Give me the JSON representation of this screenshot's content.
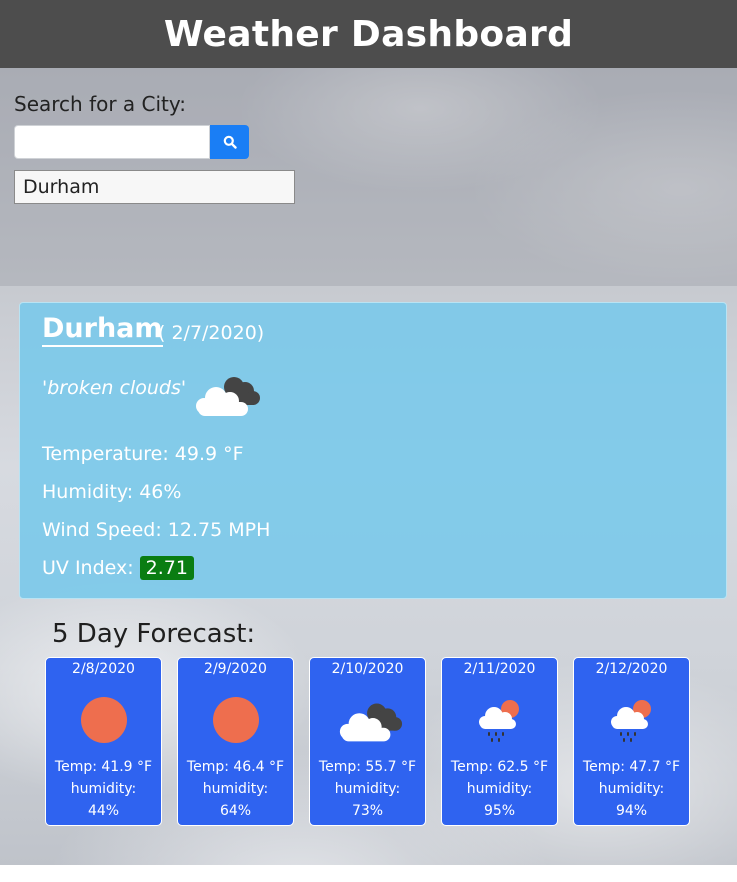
{
  "app": {
    "title": "Weather Dashboard"
  },
  "search": {
    "label": "Search for a City:",
    "input_value": "",
    "placeholder": "",
    "button_icon": "search-icon",
    "history": [
      "Durham"
    ]
  },
  "current": {
    "city": "Durham",
    "date": "( 2/7/2020)",
    "description": "'broken clouds'",
    "icon": "broken-clouds-icon",
    "temperature": "Temperature: 49.9 °F",
    "humidity": "Humidity: 46%",
    "wind": "Wind Speed: 12.75 MPH",
    "uv_label": "UV Index:",
    "uv_value": "2.71",
    "uv_color": "#0a7d12"
  },
  "forecast": {
    "title": "5 Day Forecast:",
    "humidity_label": "humidity:",
    "days": [
      {
        "date": "2/8/2020",
        "icon": "sun-icon",
        "temp": "Temp: 41.9 °F",
        "humidity": "44%"
      },
      {
        "date": "2/9/2020",
        "icon": "sun-icon",
        "temp": "Temp: 46.4 °F",
        "humidity": "64%"
      },
      {
        "date": "2/10/2020",
        "icon": "broken-clouds-icon",
        "temp": "Temp: 55.7 °F",
        "humidity": "73%"
      },
      {
        "date": "2/11/2020",
        "icon": "rain-sun-icon",
        "temp": "Temp: 62.5 °F",
        "humidity": "95%"
      },
      {
        "date": "2/12/2020",
        "icon": "rain-sun-icon",
        "temp": "Temp: 47.7 °F",
        "humidity": "94%"
      }
    ]
  },
  "colors": {
    "header_bg": "#4d4d4d",
    "search_button": "#1a7ef5",
    "current_panel": "#78c8eb",
    "forecast_card": "#2f63f0",
    "sun": "#ee6e4e"
  }
}
